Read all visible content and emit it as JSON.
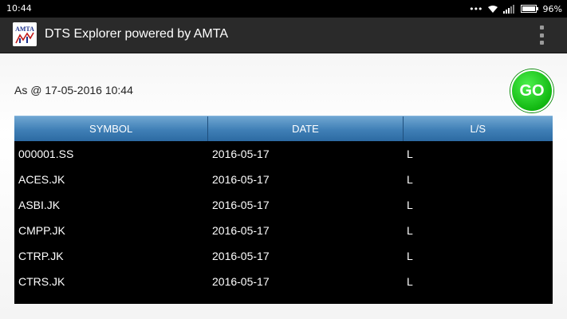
{
  "status": {
    "time": "10:44",
    "battery": "96%"
  },
  "app": {
    "title": "DTS Explorer powered by AMTA",
    "logo_text": "AMTA"
  },
  "header": {
    "asof": "As @ 17-05-2016 10:44",
    "go_label": "GO"
  },
  "table": {
    "columns": [
      "SYMBOL",
      "DATE",
      "L/S"
    ],
    "rows": [
      [
        "000001.SS",
        "2016-05-17",
        "L"
      ],
      [
        "ACES.JK",
        "2016-05-17",
        "L"
      ],
      [
        "ASBI.JK",
        "2016-05-17",
        "L"
      ],
      [
        "CMPP.JK",
        "2016-05-17",
        "L"
      ],
      [
        "CTRP.JK",
        "2016-05-17",
        "L"
      ],
      [
        "CTRS.JK",
        "2016-05-17",
        "L"
      ]
    ]
  },
  "colors": {
    "header_blue": "#3f7fb6",
    "go_green": "#12b812",
    "app_bar": "#2a2a2a"
  },
  "icons": [
    "more-dots-icon",
    "wifi-icon",
    "signal-icon",
    "battery-icon"
  ]
}
